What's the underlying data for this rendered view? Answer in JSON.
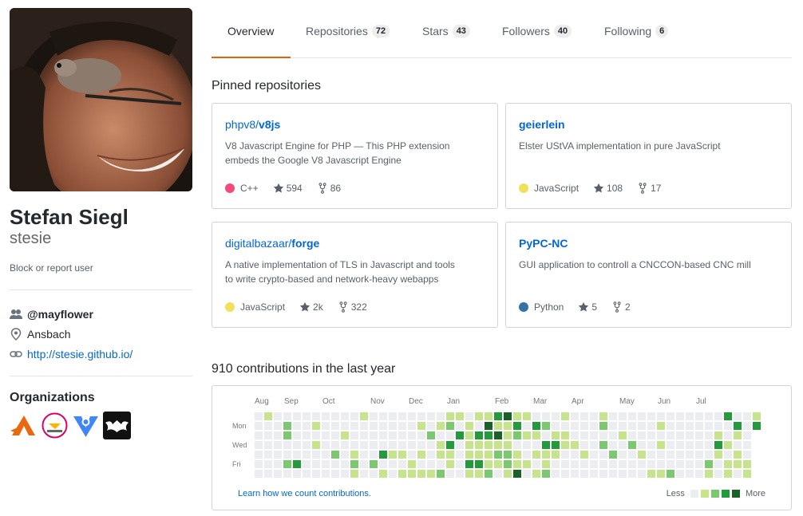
{
  "profile": {
    "fullname": "Stefan Siegl",
    "username": "stesie",
    "block_link": "Block or report user",
    "organization": "@mayflower",
    "location": "Ansbach",
    "website": "http://stesie.github.io/"
  },
  "organizations": {
    "title": "Organizations"
  },
  "tabs": [
    {
      "label": "Overview",
      "count": ""
    },
    {
      "label": "Repositories",
      "count": "72"
    },
    {
      "label": "Stars",
      "count": "43"
    },
    {
      "label": "Followers",
      "count": "40"
    },
    {
      "label": "Following",
      "count": "6"
    }
  ],
  "pinned": {
    "title": "Pinned repositories",
    "repos": [
      {
        "owner": "phpv8/",
        "name": "v8js",
        "description": "V8 Javascript Engine for PHP — This PHP extension embeds the Google V8 Javascript Engine",
        "language": "C++",
        "lang_color": "#f34b7d",
        "stars": "594",
        "forks": "86"
      },
      {
        "owner": "",
        "name": "geierlein",
        "description": "Elster UStVA implementation in pure JavaScript",
        "language": "JavaScript",
        "lang_color": "#f1e05a",
        "stars": "108",
        "forks": "17"
      },
      {
        "owner": "digitalbazaar/",
        "name": "forge",
        "description": "A native implementation of TLS in Javascript and tools to write crypto-based and network-heavy webapps",
        "language": "JavaScript",
        "lang_color": "#f1e05a",
        "stars": "2k",
        "forks": "322"
      },
      {
        "owner": "",
        "name": "PyPC-NC",
        "description": "GUI application to controll a CNCCON-based CNC mill",
        "language": "Python",
        "lang_color": "#3572A5",
        "stars": "5",
        "forks": "2"
      }
    ]
  },
  "contributions": {
    "title": "910 contributions in the last year",
    "months": [
      "Aug",
      "Sep",
      "Oct",
      "Nov",
      "Dec",
      "Jan",
      "Feb",
      "Mar",
      "Apr",
      "May",
      "Jun",
      "Jul"
    ],
    "days": [
      "Mon",
      "Wed",
      "Fri"
    ],
    "learn_link": "Learn how we count contributions.",
    "legend_less": "Less",
    "legend_more": "More",
    "colors": [
      "#ebedf0",
      "#c6e48b",
      "#7bc96f",
      "#239a3b",
      "#196127"
    ]
  }
}
